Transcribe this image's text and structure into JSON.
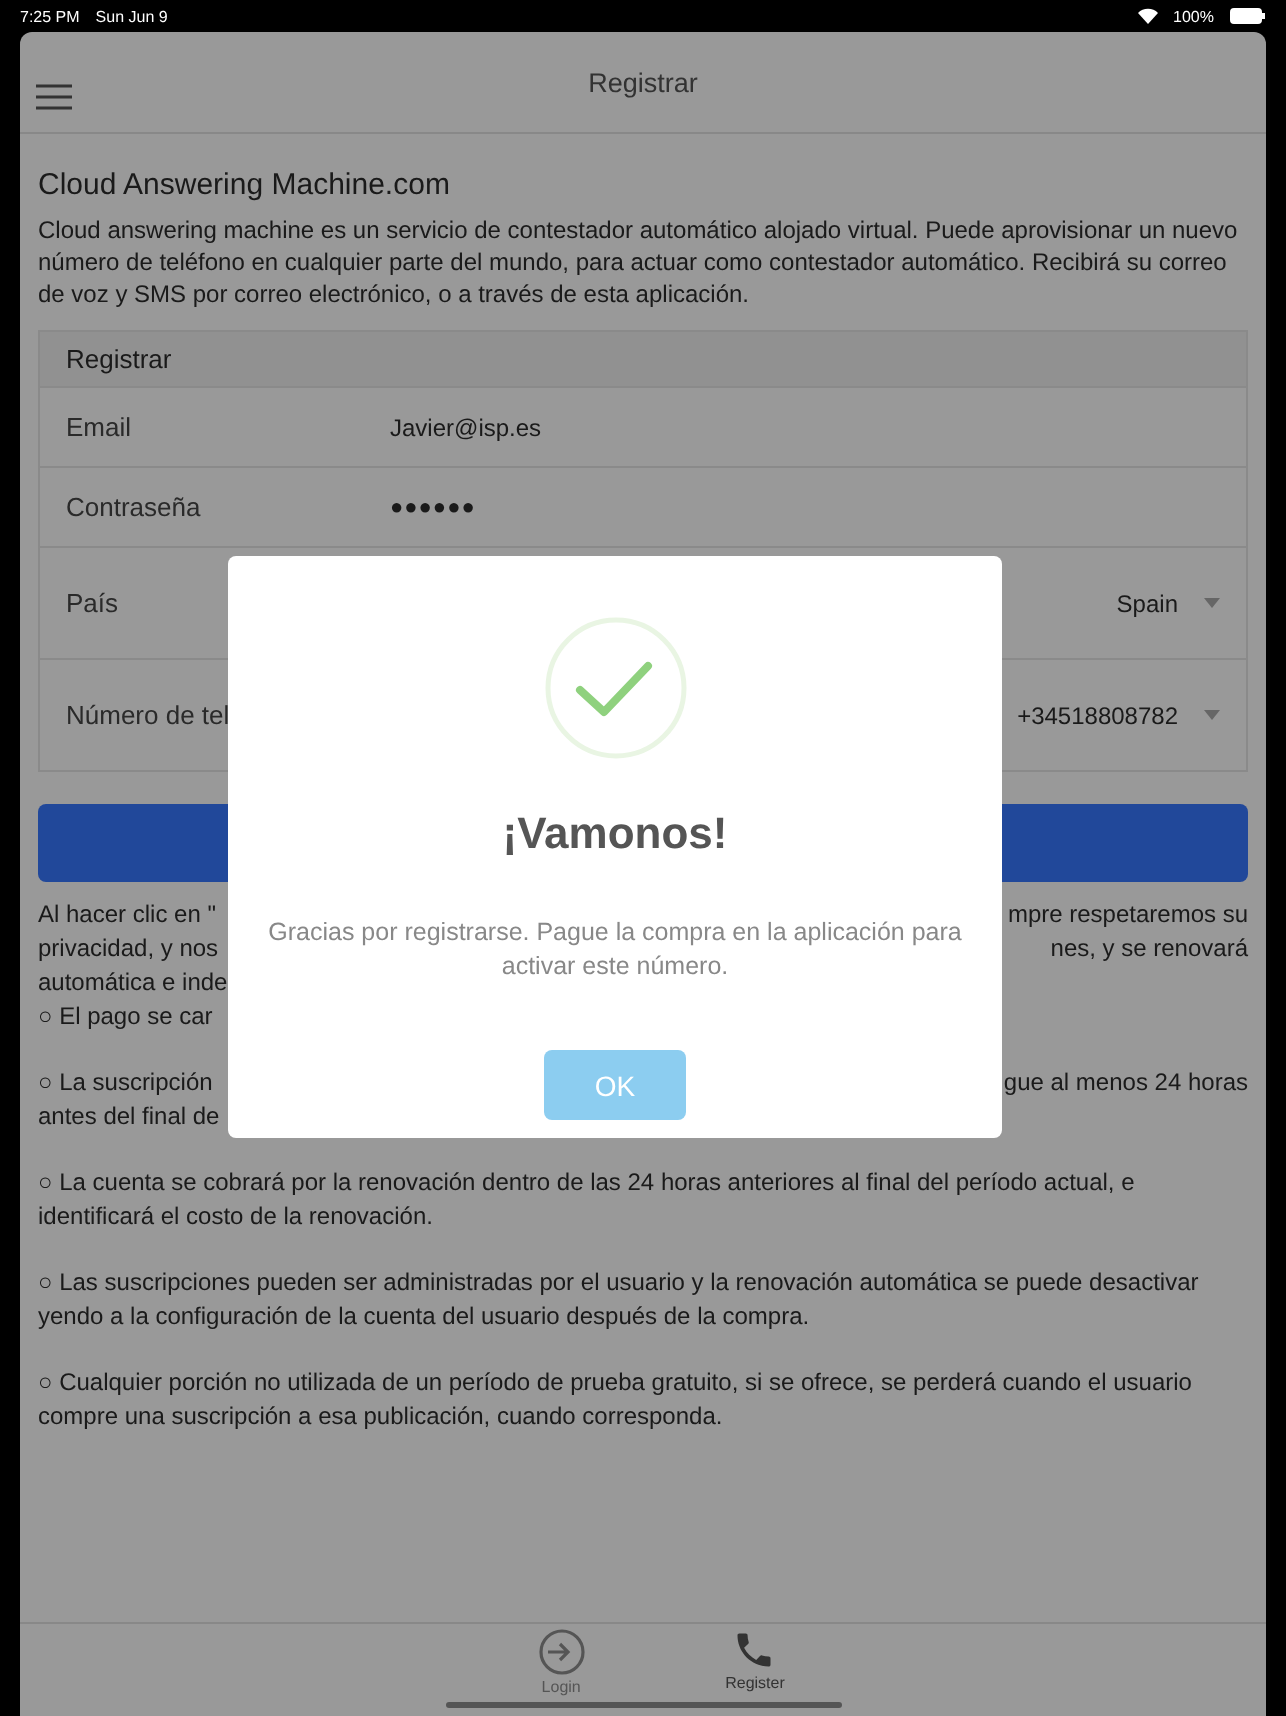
{
  "status_bar": {
    "time": "7:25 PM",
    "date": "Sun Jun 9",
    "battery": "100%"
  },
  "nav": {
    "title": "Registrar"
  },
  "heading": "Cloud Answering Machine.com",
  "description": "Cloud answering machine es un servicio de contestador automático alojado virtual. Puede aprovisionar un nuevo número de teléfono en cualquier parte del mundo, para actuar como contestador automático. Recibirá su correo de voz y SMS por correo electrónico, o a través de esta aplicación.",
  "form": {
    "title": "Registrar",
    "fields": [
      {
        "kind": "text",
        "label": "Email",
        "value": "Javier@isp.es"
      },
      {
        "kind": "password",
        "label": "Contraseña",
        "value": "●●●●●●"
      },
      {
        "kind": "select",
        "label": "País",
        "value": "Spain"
      },
      {
        "kind": "select",
        "label": "Número de tel",
        "value": "+34518808782"
      }
    ]
  },
  "terms": [
    {
      "kind": "covered",
      "lines": [
        {
          "left": "Al hacer clic en \"",
          "right": "mpre respetaremos su"
        },
        {
          "left": "privacidad, y nos",
          "right": "nes, y se renovará"
        },
        {
          "left": "automática e inde"
        }
      ]
    },
    {
      "kind": "covered",
      "lines": [
        {
          "left": "○ El pago se car"
        }
      ]
    },
    {
      "kind": "covered",
      "lines": [
        {
          "left": "○ La suscripción",
          "right": "gue al menos 24 horas"
        },
        {
          "left": "antes del final de"
        }
      ]
    },
    {
      "kind": "full",
      "text": "○ La cuenta se cobrará por la renovación dentro de las 24 horas anteriores al final del período actual, e identificará el costo de la renovación."
    },
    {
      "kind": "full",
      "text": "○ Las suscripciones pueden ser administradas por el usuario y la renovación automática se puede desactivar yendo a la configuración de la cuenta del usuario después de la compra."
    },
    {
      "kind": "full",
      "text": "○ Cualquier porción no utilizada de un período de prueba gratuito, si se ofrece, se perderá cuando el usuario compre una suscripción a esa publicación, cuando corresponda."
    }
  ],
  "tabs": [
    {
      "label": "Login",
      "kind": "login",
      "selected": false
    },
    {
      "label": "Register",
      "kind": "phone",
      "selected": true
    }
  ],
  "dialog": {
    "title": "¡Vamonos!",
    "message": "Gracias por registrarse. Pague la compra en la aplicación para activar este número.",
    "button": "OK"
  }
}
